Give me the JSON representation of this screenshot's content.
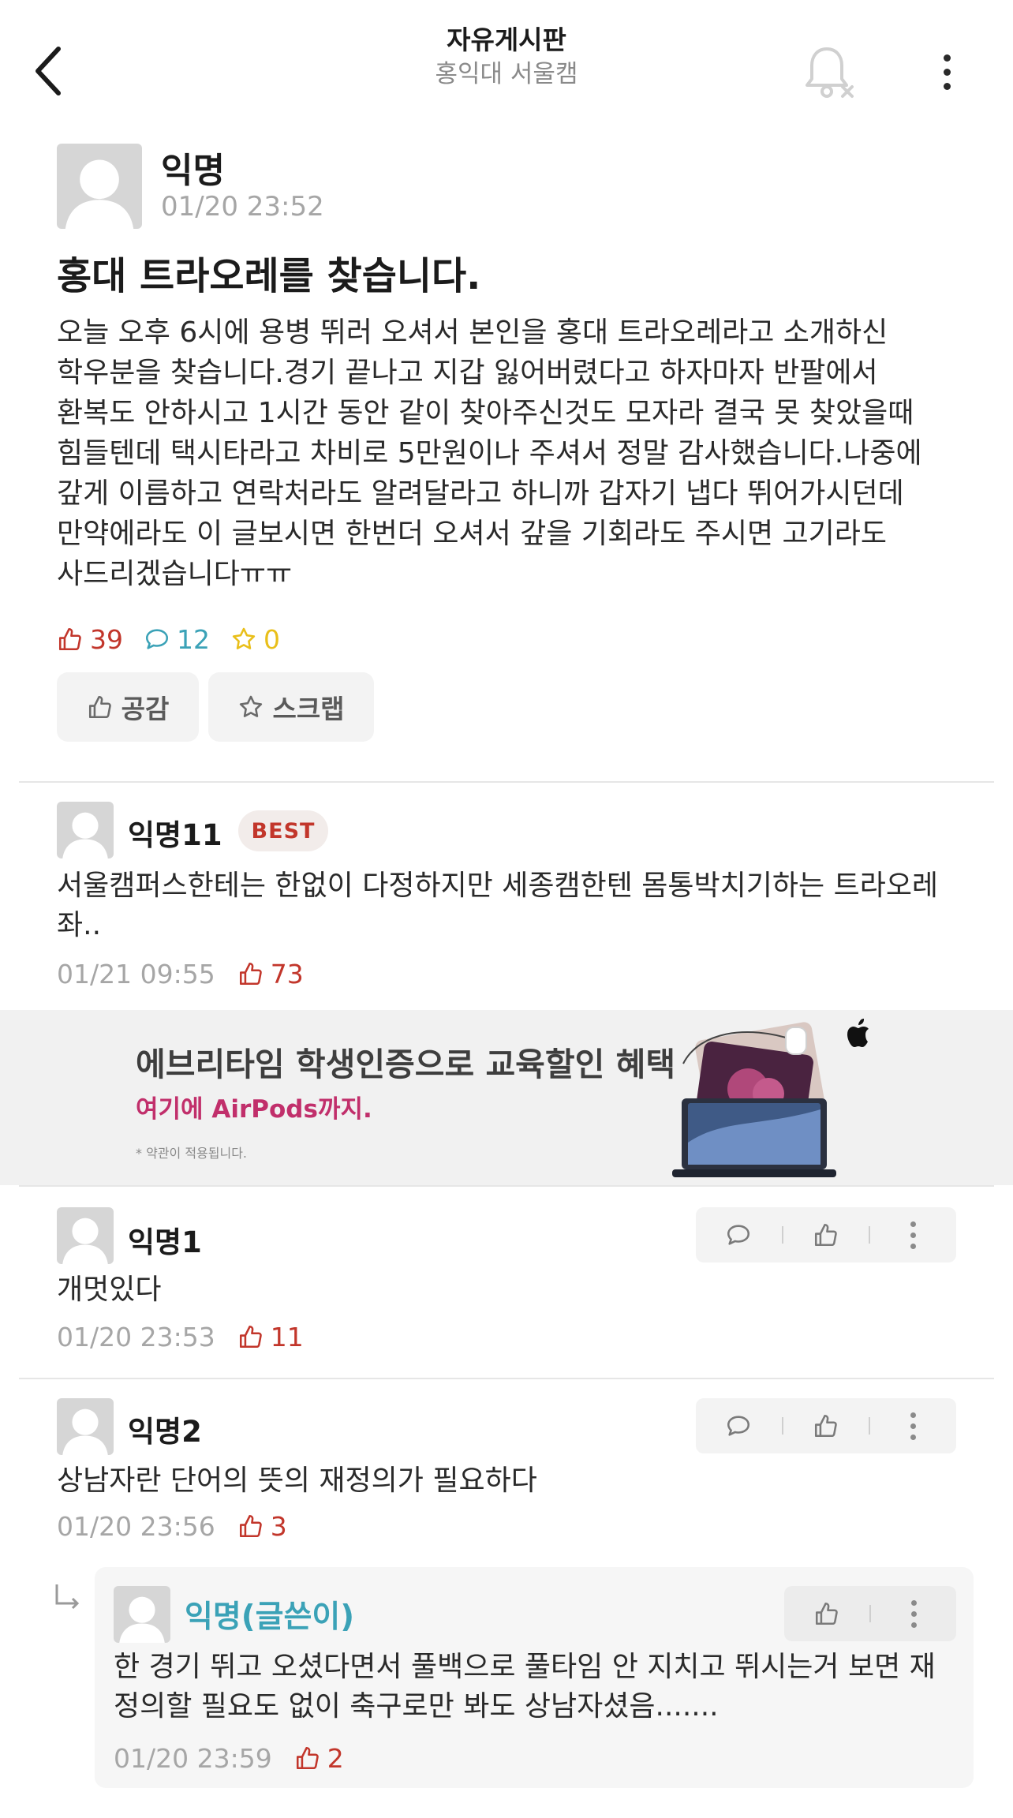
{
  "header": {
    "title": "자유게시판",
    "subtitle": "홍익대 서울캠"
  },
  "post": {
    "author": "익명",
    "time": "01/20 23:52",
    "title": "홍대 트라오레를 찾습니다.",
    "body": "오늘 오후 6시에 용병 뛰러 오셔서 본인을 홍대 트라오레라고 소개하신 학우분을 찾습니다.경기 끝나고 지갑 잃어버렸다고 하자마자 반팔에서 환복도 안하시고 1시간 동안 같이 찾아주신것도 모자라 결국 못 찾았을때 힘들텐데 택시타라고 차비로 5만원이나 주셔서 정말 감사했습니다.나중에 갚게 이름하고 연락처라도 알려달라고 하니까 갑자기 냅다 뛰어가시던데 만약에라도 이 글보시면 한번더 오셔서 갚을 기회라도 주시면 고기라도 사드리겠습니다ㅠㅠ",
    "likes": "39",
    "comments": "12",
    "scraps": "0",
    "like_button": "공감",
    "scrap_button": "스크랩"
  },
  "best_comment": {
    "author": "익명11",
    "badge": "BEST",
    "text": "서울캠퍼스한테는 한없이 다정하지만 세종캠한텐 몸통박치기하는 트라오레좌..",
    "time": "01/21 09:55",
    "likes": "73"
  },
  "ad": {
    "headline": "에브리타임 학생인증으로 교육할인 혜택",
    "subline": "여기에 AirPods까지.",
    "note": "* 약관이 적용됩니다."
  },
  "comments": [
    {
      "author": "익명1",
      "text": "개멋있다",
      "time": "01/20 23:53",
      "likes": "11"
    },
    {
      "author": "익명2",
      "text": "상남자란 단어의 뜻의 재정의가 필요하다",
      "time": "01/20 23:56",
      "likes": "3"
    }
  ],
  "reply": {
    "author": "익명(글쓴이)",
    "text": "한 경기 뛰고 오셨다면서 풀백으로 풀타임 안 지치고 뛰시는거 보면 재정의할 필요도 없이 축구로만 봐도 상남자셨음.......",
    "time": "01/20 23:59",
    "likes": "2"
  },
  "colors": {
    "accent_red": "#c2362b",
    "accent_teal": "#3ba2b7",
    "accent_yellow": "#e9bf1a",
    "ad_pink": "#c12f6b"
  },
  "icons": [
    "back-icon",
    "bell-off-icon",
    "more-vertical-icon",
    "thumbs-up-icon",
    "comment-icon",
    "star-icon",
    "reply-arrow-icon",
    "apple-logo-icon"
  ]
}
